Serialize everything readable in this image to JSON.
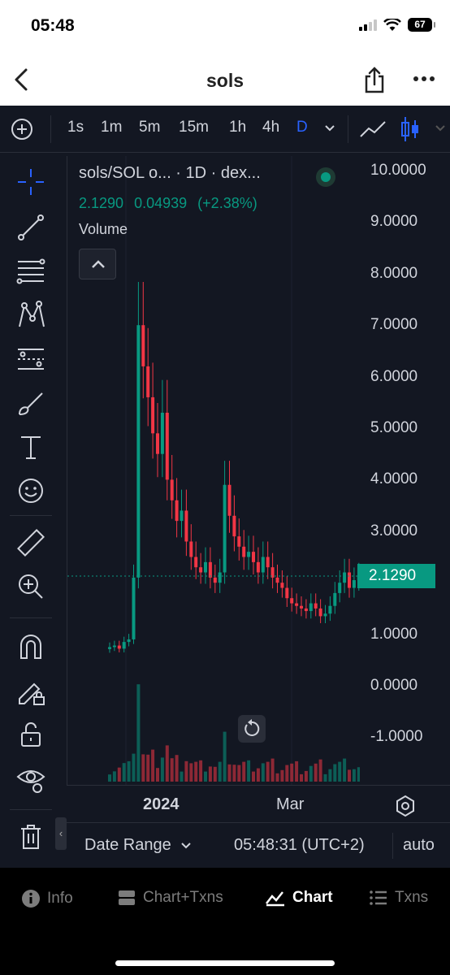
{
  "status": {
    "time": "05:48",
    "battery": "67"
  },
  "nav": {
    "title": "sols"
  },
  "toolbar": {
    "timeframes": [
      "1s",
      "1m",
      "5m",
      "15m",
      "1h",
      "4h",
      "D"
    ],
    "active_timeframe": "D"
  },
  "legend": {
    "title": "sols/SOL o...  · 1D · dex...",
    "close": "2.1290",
    "change": "0.04939",
    "change_pct": "(+2.38%)",
    "volume_label": "Volume"
  },
  "price_axis": {
    "ticks": [
      "10.0000",
      "9.0000",
      "8.0000",
      "7.0000",
      "6.0000",
      "5.0000",
      "4.0000",
      "3.0000",
      "2.0000",
      "1.0000",
      "0.0000",
      "-1.0000"
    ],
    "last_price": "2.1290"
  },
  "time_axis": {
    "year_label": "2024",
    "month_label": "Mar"
  },
  "bottom": {
    "date_range": "Date Range",
    "clock": "05:48:31 (UTC+2)",
    "scale": "auto"
  },
  "tabs": [
    {
      "label": "Info",
      "icon": "info-icon"
    },
    {
      "label": "Chart+Txns",
      "icon": "split-view-icon"
    },
    {
      "label": "Chart",
      "icon": "chart-icon"
    },
    {
      "label": "Txns",
      "icon": "list-icon"
    }
  ],
  "colors": {
    "up": "#089981",
    "down": "#f23645",
    "background": "#131722",
    "accent": "#2962ff"
  },
  "chart_data": {
    "type": "candlestick",
    "interval": "1D",
    "ylim": [
      -1.5,
      10.2
    ],
    "close_series": [
      0.75,
      0.78,
      0.72,
      0.85,
      0.9,
      2.1,
      7.0,
      6.2,
      5.6,
      4.9,
      4.5,
      5.3,
      4.0,
      3.6,
      3.2,
      3.4,
      2.8,
      2.5,
      2.3,
      2.2,
      2.4,
      2.1,
      2.0,
      2.2,
      3.9,
      3.3,
      2.9,
      2.7,
      2.5,
      2.6,
      2.4,
      2.2,
      2.5,
      2.3,
      2.1,
      2.0,
      1.9,
      1.7,
      1.6,
      1.55,
      1.5,
      1.45,
      1.6,
      1.5,
      1.35,
      1.4,
      1.55,
      1.8,
      2.0,
      2.2,
      1.9,
      2.05,
      2.13
    ],
    "last_price": 2.129
  }
}
